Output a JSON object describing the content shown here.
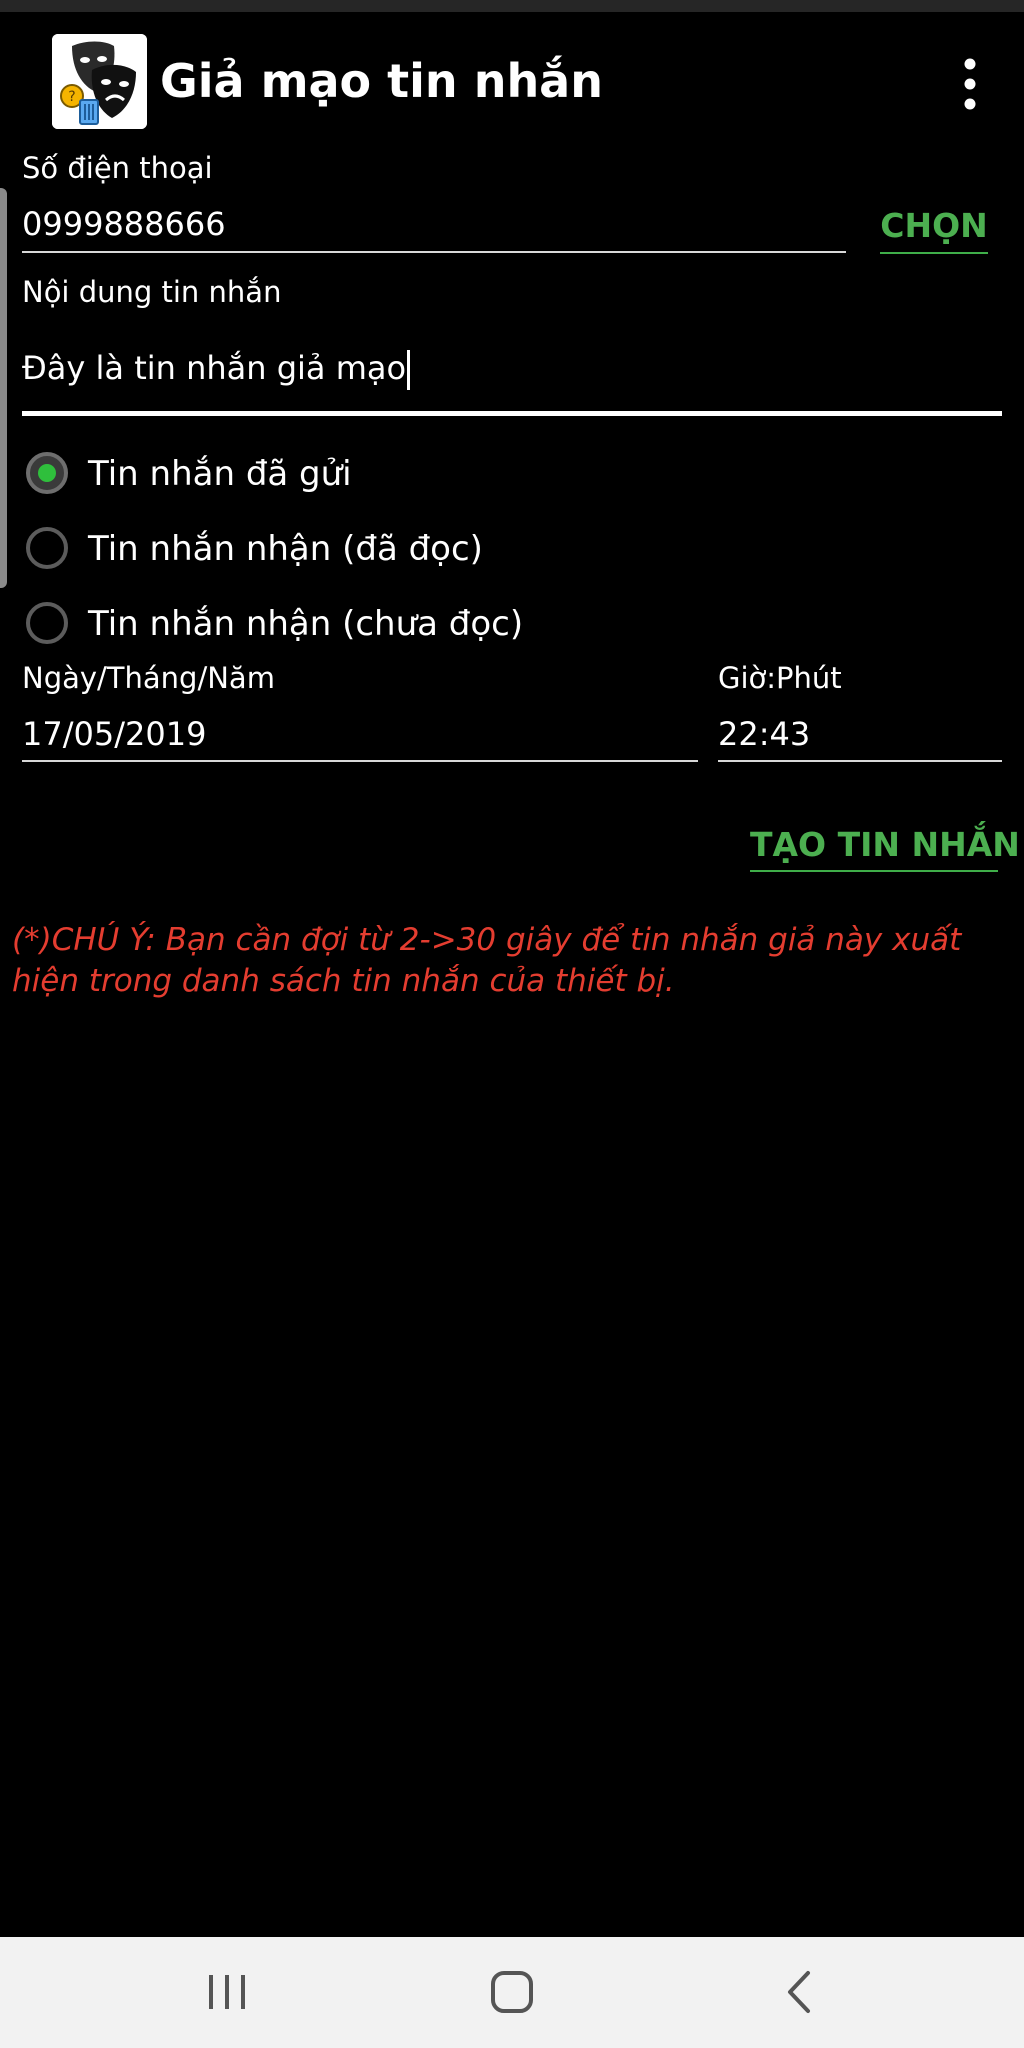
{
  "app": {
    "title": "Giả mạo tin nhắn"
  },
  "phone": {
    "label": "Số điện thoại",
    "value": "0999888666",
    "pick_label": "CHỌN"
  },
  "message": {
    "label": "Nội dung tin nhắn",
    "value": "Đây là tin nhắn giả mạo"
  },
  "message_type": {
    "options": [
      {
        "label": "Tin nhắn đã gửi",
        "checked": true
      },
      {
        "label": "Tin nhắn nhận (đã đọc)",
        "checked": false
      },
      {
        "label": "Tin nhắn nhận (chưa đọc)",
        "checked": false
      }
    ]
  },
  "date": {
    "label": "Ngày/Tháng/Năm",
    "value": "17/05/2019"
  },
  "time": {
    "label": "Giờ:Phút",
    "value": "22:43"
  },
  "actions": {
    "create_label": "TẠO TIN NHẮN"
  },
  "notice": {
    "text": "(*)CHÚ Ý: Bạn cần đợi từ 2->30 giây để tin nhắn giả này xuất hiện trong danh sách tin nhắn của thiết bị."
  },
  "colors": {
    "accent_green": "#4caf50",
    "warning_red": "#e43d30",
    "background": "#000000"
  },
  "icons": {
    "app": "theater-masks-icon",
    "overflow": "more-vert-icon",
    "nav_recents": "recents-icon",
    "nav_home": "home-icon",
    "nav_back": "back-icon"
  }
}
